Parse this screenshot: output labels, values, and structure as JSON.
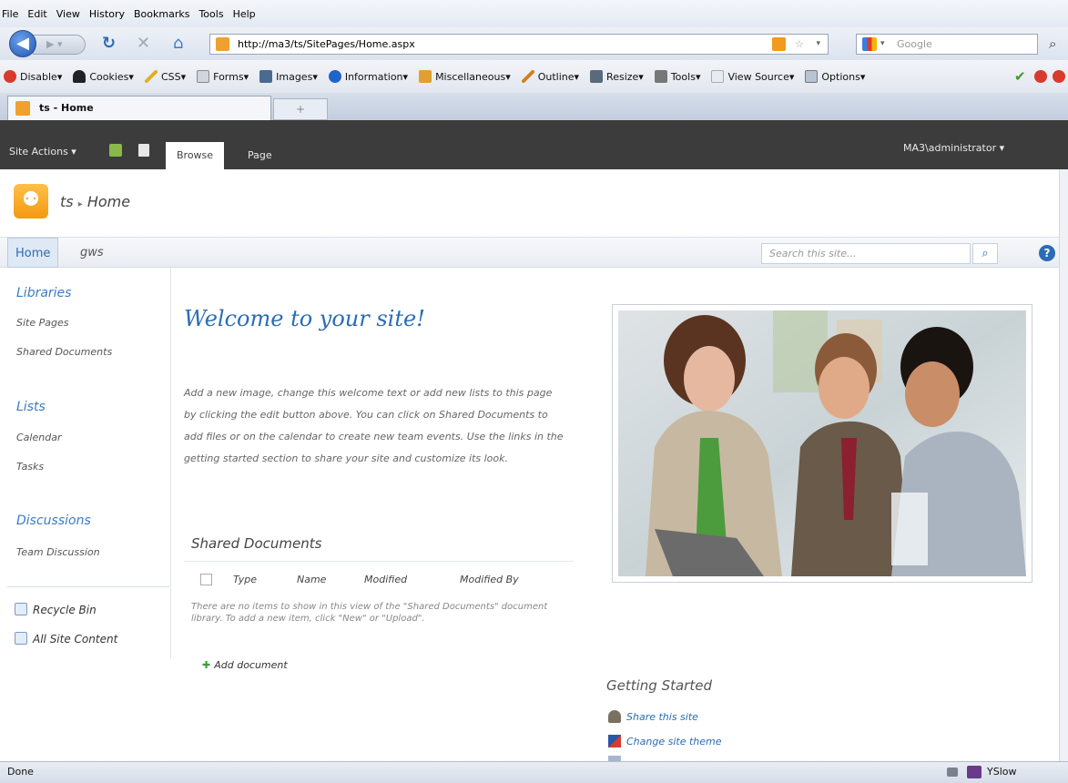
{
  "browser": {
    "menu": [
      "File",
      "Edit",
      "View",
      "History",
      "Bookmarks",
      "Tools",
      "Help"
    ],
    "url": "http://ma3/ts/SitePages/Home.aspx",
    "search_placeholder": "Google",
    "toolbar": [
      "Disable",
      "Cookies",
      "CSS",
      "Forms",
      "Images",
      "Information",
      "Miscellaneous",
      "Outline",
      "Resize",
      "Tools",
      "View Source",
      "Options"
    ],
    "tab_title": "ts - Home",
    "new_tab": "+",
    "status": "Done",
    "yslow": "YSlow"
  },
  "ribbon": {
    "site_actions": "Site Actions",
    "tabs": [
      "Browse",
      "Page"
    ],
    "user": "MA3\\administrator"
  },
  "title_area": {
    "site": "ts",
    "separator": "▸",
    "page": "Home"
  },
  "top_nav": {
    "items": [
      "Home",
      "gws"
    ],
    "search_placeholder": "Search this site..."
  },
  "quick_launch": {
    "libraries": "Libraries",
    "library_items": [
      "Site Pages",
      "Shared Documents"
    ],
    "lists": "Lists",
    "list_items": [
      "Calendar",
      "Tasks"
    ],
    "discussions": "Discussions",
    "discussion_items": [
      "Team Discussion"
    ],
    "recycle_bin": "Recycle Bin",
    "all_site_content": "All Site Content"
  },
  "main": {
    "welcome": "Welcome to your site!",
    "body": "Add a new image, change this welcome text or add new lists to this page by clicking the edit button above. You can click on Shared Documents to add files or on the calendar to create new team events. Use the links in the getting started section to share your site and customize its look.",
    "shared_docs": {
      "title": "Shared Documents",
      "columns": [
        "Type",
        "Name",
        "Modified",
        "Modified By"
      ],
      "empty": "There are no items to show in this view of the \"Shared Documents\" document library. To add a new item, click \"New\" or \"Upload\".",
      "add": "Add document"
    },
    "getting_started": {
      "title": "Getting Started",
      "items": [
        "Share this site",
        "Change site theme"
      ]
    }
  },
  "colors": {
    "ribbon_bg": "#3c3c3c",
    "link_blue": "#2a6cb5",
    "site_icon": "#f39a10"
  }
}
